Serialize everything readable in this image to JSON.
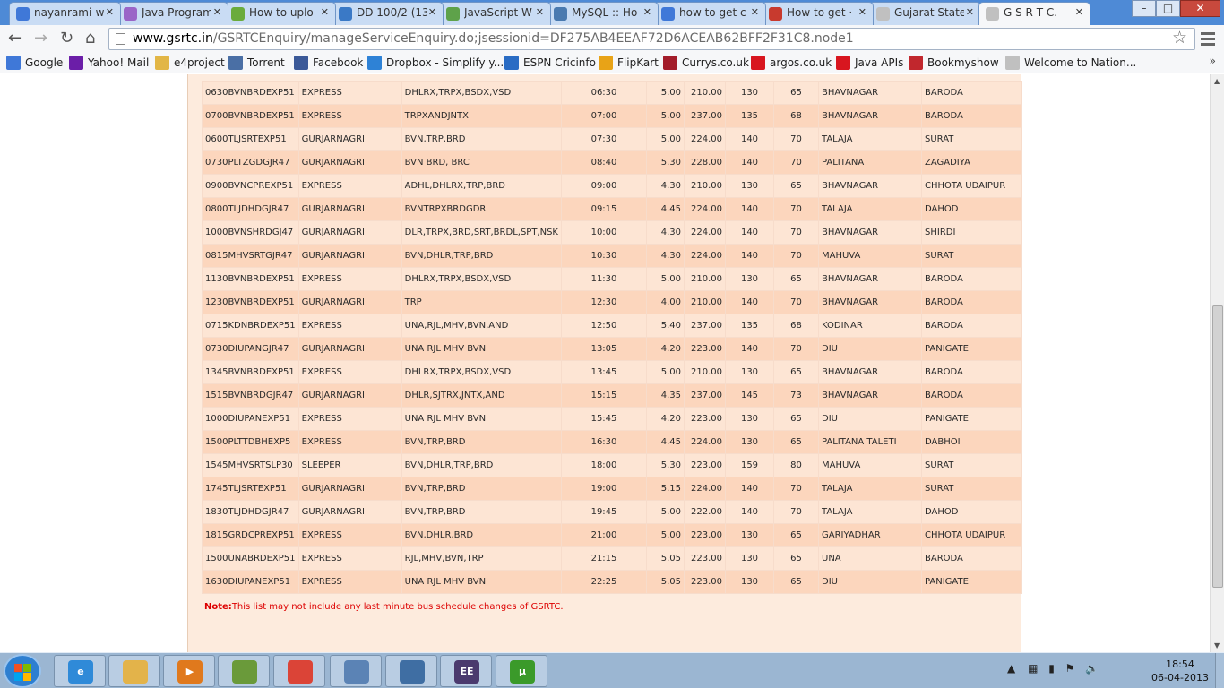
{
  "tabs": [
    {
      "label": "nayanrami-w",
      "icon": "google-icon",
      "color": "#3f78d8"
    },
    {
      "label": "Java Program",
      "icon": "java-site-icon",
      "color": "#9a65c7"
    },
    {
      "label": "How to uplo",
      "icon": "stackexchange-icon",
      "color": "#6aab3c"
    },
    {
      "label": "DD 100/2 (13",
      "icon": "c-icon",
      "color": "#3a79c6"
    },
    {
      "label": "JavaScript W",
      "icon": "w3-icon",
      "color": "#5ea24a"
    },
    {
      "label": "MySQL :: Ho",
      "icon": "mysql-icon",
      "color": "#4a7ab0"
    },
    {
      "label": "how to get c",
      "icon": "google-icon",
      "color": "#3f78d8"
    },
    {
      "label": "How to get ·",
      "icon": "bus-icon",
      "color": "#c83a2e"
    },
    {
      "label": "Gujarat State",
      "icon": "page-icon",
      "color": "#c0c0c0"
    },
    {
      "label": "G S R T C.",
      "icon": "page-icon",
      "color": "#c0c0c0"
    }
  ],
  "window_buttons": {
    "minimize": "–",
    "maximize": "□",
    "close": "✕"
  },
  "address": {
    "domain": "www.gsrtc.in",
    "path": "/GSRTCEnquiry/manageServiceEnquiry.do;jsessionid=DF275AB4EEAF72D6ACEAB62BFF2F31C8.node1"
  },
  "bookmarks": [
    {
      "label": "Google",
      "icon": "google-icon",
      "color": "#3f78d8"
    },
    {
      "label": "Yahoo! Mail",
      "icon": "yahoo-icon",
      "color": "#6b1ea8"
    },
    {
      "label": "e4project",
      "icon": "folder-icon",
      "color": "#e2b646"
    },
    {
      "label": "Torrent",
      "icon": "torrentz-icon",
      "color": "#4a6fa5"
    },
    {
      "label": "Facebook",
      "icon": "facebook-icon",
      "color": "#3b5998"
    },
    {
      "label": "Dropbox - Simplify y...",
      "icon": "dropbox-icon",
      "color": "#2e82d6"
    },
    {
      "label": "ESPN Cricinfo",
      "icon": "cricinfo-icon",
      "color": "#2a6cc4"
    },
    {
      "label": "FlipKart",
      "icon": "flipkart-icon",
      "color": "#e8a317"
    },
    {
      "label": "Currys.co.uk",
      "icon": "currys-icon",
      "color": "#a31c2a"
    },
    {
      "label": "argos.co.uk",
      "icon": "argos-icon",
      "color": "#d8161f"
    },
    {
      "label": "Java APIs",
      "icon": "oracle-icon",
      "color": "#d8161f"
    },
    {
      "label": "Bookmyshow",
      "icon": "bookmyshow-icon",
      "color": "#c1272d"
    },
    {
      "label": "Welcome to Nation...",
      "icon": "page-icon",
      "color": "#c0c0c0"
    }
  ],
  "bookmarks_more": "»",
  "schedule": [
    [
      "0630BVNBRDEXP51",
      "EXPRESS",
      "DHLRX,TRPX,BSDX,VSD",
      "06:30",
      "5.00",
      "210.00",
      "130",
      "65",
      "BHAVNAGAR",
      "BARODA"
    ],
    [
      "0700BVNBRDEXP51",
      "EXPRESS",
      "TRPXANDJNTX",
      "07:00",
      "5.00",
      "237.00",
      "135",
      "68",
      "BHAVNAGAR",
      "BARODA"
    ],
    [
      "0600TLJSRTEXP51",
      "GURJARNAGRI",
      "BVN,TRP,BRD",
      "07:30",
      "5.00",
      "224.00",
      "140",
      "70",
      "TALAJA",
      "SURAT"
    ],
    [
      "0730PLTZGDGJR47",
      "GURJARNAGRI",
      "BVN BRD, BRC",
      "08:40",
      "5.30",
      "228.00",
      "140",
      "70",
      "PALITANA",
      "ZAGADIYA"
    ],
    [
      "0900BVNCPREXP51",
      "EXPRESS",
      "ADHL,DHLRX,TRP,BRD",
      "09:00",
      "4.30",
      "210.00",
      "130",
      "65",
      "BHAVNAGAR",
      "CHHOTA UDAIPUR"
    ],
    [
      "0800TLJDHDGJR47",
      "GURJARNAGRI",
      "BVNTRPXBRDGDR",
      "09:15",
      "4.45",
      "224.00",
      "140",
      "70",
      "TALAJA",
      "DAHOD"
    ],
    [
      "1000BVNSHRDGJ47",
      "GURJARNAGRI",
      "DLR,TRPX,BRD,SRT,BRDL,SPT,NSK",
      "10:00",
      "4.30",
      "224.00",
      "140",
      "70",
      "BHAVNAGAR",
      "SHIRDI"
    ],
    [
      "0815MHVSRTGJR47",
      "GURJARNAGRI",
      "BVN,DHLR,TRP,BRD",
      "10:30",
      "4.30",
      "224.00",
      "140",
      "70",
      "MAHUVA",
      "SURAT"
    ],
    [
      "1130BVNBRDEXP51",
      "EXPRESS",
      "DHLRX,TRPX,BSDX,VSD",
      "11:30",
      "5.00",
      "210.00",
      "130",
      "65",
      "BHAVNAGAR",
      "BARODA"
    ],
    [
      "1230BVNBRDEXP51",
      "GURJARNAGRI",
      "TRP",
      "12:30",
      "4.00",
      "210.00",
      "140",
      "70",
      "BHAVNAGAR",
      "BARODA"
    ],
    [
      "0715KDNBRDEXP51",
      "EXPRESS",
      "UNA,RJL,MHV,BVN,AND",
      "12:50",
      "5.40",
      "237.00",
      "135",
      "68",
      "KODINAR",
      "BARODA"
    ],
    [
      "0730DIUPANGJR47",
      "GURJARNAGRI",
      "UNA RJL MHV BVN",
      "13:05",
      "4.20",
      "223.00",
      "140",
      "70",
      "DIU",
      "PANIGATE"
    ],
    [
      "1345BVNBRDEXP51",
      "EXPRESS",
      "DHLRX,TRPX,BSDX,VSD",
      "13:45",
      "5.00",
      "210.00",
      "130",
      "65",
      "BHAVNAGAR",
      "BARODA"
    ],
    [
      "1515BVNBRDGJR47",
      "GURJARNAGRI",
      "DHLR,SJTRX,JNTX,AND",
      "15:15",
      "4.35",
      "237.00",
      "145",
      "73",
      "BHAVNAGAR",
      "BARODA"
    ],
    [
      "1000DIUPANEXP51",
      "EXPRESS",
      "UNA RJL MHV BVN",
      "15:45",
      "4.20",
      "223.00",
      "130",
      "65",
      "DIU",
      "PANIGATE"
    ],
    [
      "1500PLTTDBHEXP5",
      "EXPRESS",
      "BVN,TRP,BRD",
      "16:30",
      "4.45",
      "224.00",
      "130",
      "65",
      "PALITANA TALETI",
      "DABHOI"
    ],
    [
      "1545MHVSRTSLP30",
      "SLEEPER",
      "BVN,DHLR,TRP,BRD",
      "18:00",
      "5.30",
      "223.00",
      "159",
      "80",
      "MAHUVA",
      "SURAT"
    ],
    [
      "1745TLJSRTEXP51",
      "GURJARNAGRI",
      "BVN,TRP,BRD",
      "19:00",
      "5.15",
      "224.00",
      "140",
      "70",
      "TALAJA",
      "SURAT"
    ],
    [
      "1830TLJDHDGJR47",
      "GURJARNAGRI",
      "BVN,TRP,BRD",
      "19:45",
      "5.00",
      "222.00",
      "140",
      "70",
      "TALAJA",
      "DAHOD"
    ],
    [
      "1815GRDCPREXP51",
      "EXPRESS",
      "BVN,DHLR,BRD",
      "21:00",
      "5.00",
      "223.00",
      "130",
      "65",
      "GARIYADHAR",
      "CHHOTA UDAIPUR"
    ],
    [
      "1500UNABRDEXP51",
      "EXPRESS",
      "RJL,MHV,BVN,TRP",
      "21:15",
      "5.05",
      "223.00",
      "130",
      "65",
      "UNA",
      "BARODA"
    ],
    [
      "1630DIUPANEXP51",
      "EXPRESS",
      "UNA RJL MHV BVN",
      "22:25",
      "5.05",
      "223.00",
      "130",
      "65",
      "DIU",
      "PANIGATE"
    ]
  ],
  "note": {
    "label": "Note:",
    "text": "This list may not include any last minute bus schedule changes of GSRTC."
  },
  "taskbar": {
    "apps": [
      {
        "name": "ie-icon",
        "color": "#2f8ad8",
        "glyph": "e"
      },
      {
        "name": "explorer-icon",
        "color": "#e3b34a",
        "glyph": ""
      },
      {
        "name": "media-player-icon",
        "color": "#e0791d",
        "glyph": "▶"
      },
      {
        "name": "notepad-icon",
        "color": "#6a9a3a",
        "glyph": ""
      },
      {
        "name": "chrome-icon",
        "color": "#db4437",
        "glyph": ""
      },
      {
        "name": "remote-desktop-icon",
        "color": "#5b83b5",
        "glyph": ""
      },
      {
        "name": "mysql-workbench-icon",
        "color": "#3f6ea3",
        "glyph": ""
      },
      {
        "name": "eclipse-java-ee-icon",
        "color": "#4b3a6e",
        "glyph": "EE"
      },
      {
        "name": "utorrent-icon",
        "color": "#3b9a2a",
        "glyph": "µ"
      }
    ],
    "time": "18:54",
    "date": "06-04-2013"
  }
}
